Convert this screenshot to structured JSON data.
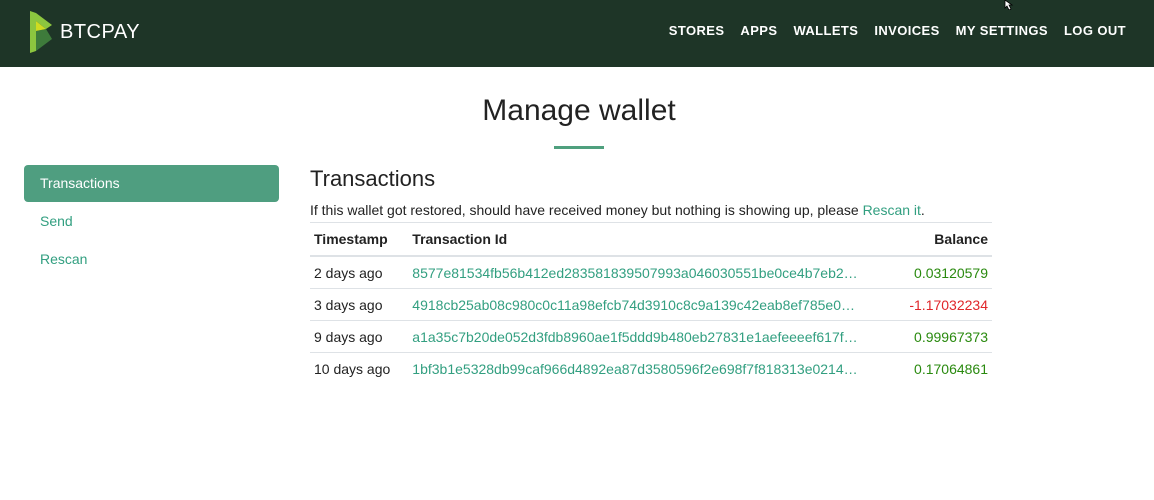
{
  "header": {
    "brand": "BTCPAY",
    "nav": [
      {
        "label": "STORES"
      },
      {
        "label": "APPS"
      },
      {
        "label": "WALLETS"
      },
      {
        "label": "INVOICES"
      },
      {
        "label": "MY SETTINGS"
      },
      {
        "label": "LOG OUT"
      }
    ],
    "colors": {
      "bar": "#1e3527",
      "logo_green": "#8cc63f",
      "logo_dark": "#3e7b3b"
    }
  },
  "page": {
    "title": "Manage wallet"
  },
  "sidebar": {
    "items": [
      {
        "label": "Transactions",
        "active": true
      },
      {
        "label": "Send",
        "active": false
      },
      {
        "label": "Rescan",
        "active": false
      }
    ]
  },
  "main": {
    "title": "Transactions",
    "help_text": "If this wallet got restored, should have received money but nothing is showing up, please ",
    "help_link": "Rescan it",
    "help_suffix": ".",
    "table": {
      "headers": {
        "timestamp": "Timestamp",
        "txid": "Transaction Id",
        "balance": "Balance"
      },
      "rows": [
        {
          "timestamp": "2 days ago",
          "txid": "8577e81534fb56b412ed283581839507993a046030551be0ce4b7eb2…",
          "balance": "0.03120579",
          "sign": "positive"
        },
        {
          "timestamp": "3 days ago",
          "txid": "4918cb25ab08c980c0c11a98efcb74d3910c8c9a139c42eab8ef785e0…",
          "balance": "-1.17032234",
          "sign": "negative"
        },
        {
          "timestamp": "9 days ago",
          "txid": "a1a35c7b20de052d3fdb8960ae1f5ddd9b480eb27831e1aefeeeef617f…",
          "balance": "0.99967373",
          "sign": "positive"
        },
        {
          "timestamp": "10 days ago",
          "txid": "1bf3b1e5328db99caf966d4892ea87d3580596f2e698f7f818313e0214…",
          "balance": "0.17064861",
          "sign": "positive"
        }
      ]
    },
    "colors": {
      "link": "#329f80",
      "positive": "#2a8a0f",
      "negative": "#e0262a",
      "active_bg": "#4f9e80"
    }
  }
}
